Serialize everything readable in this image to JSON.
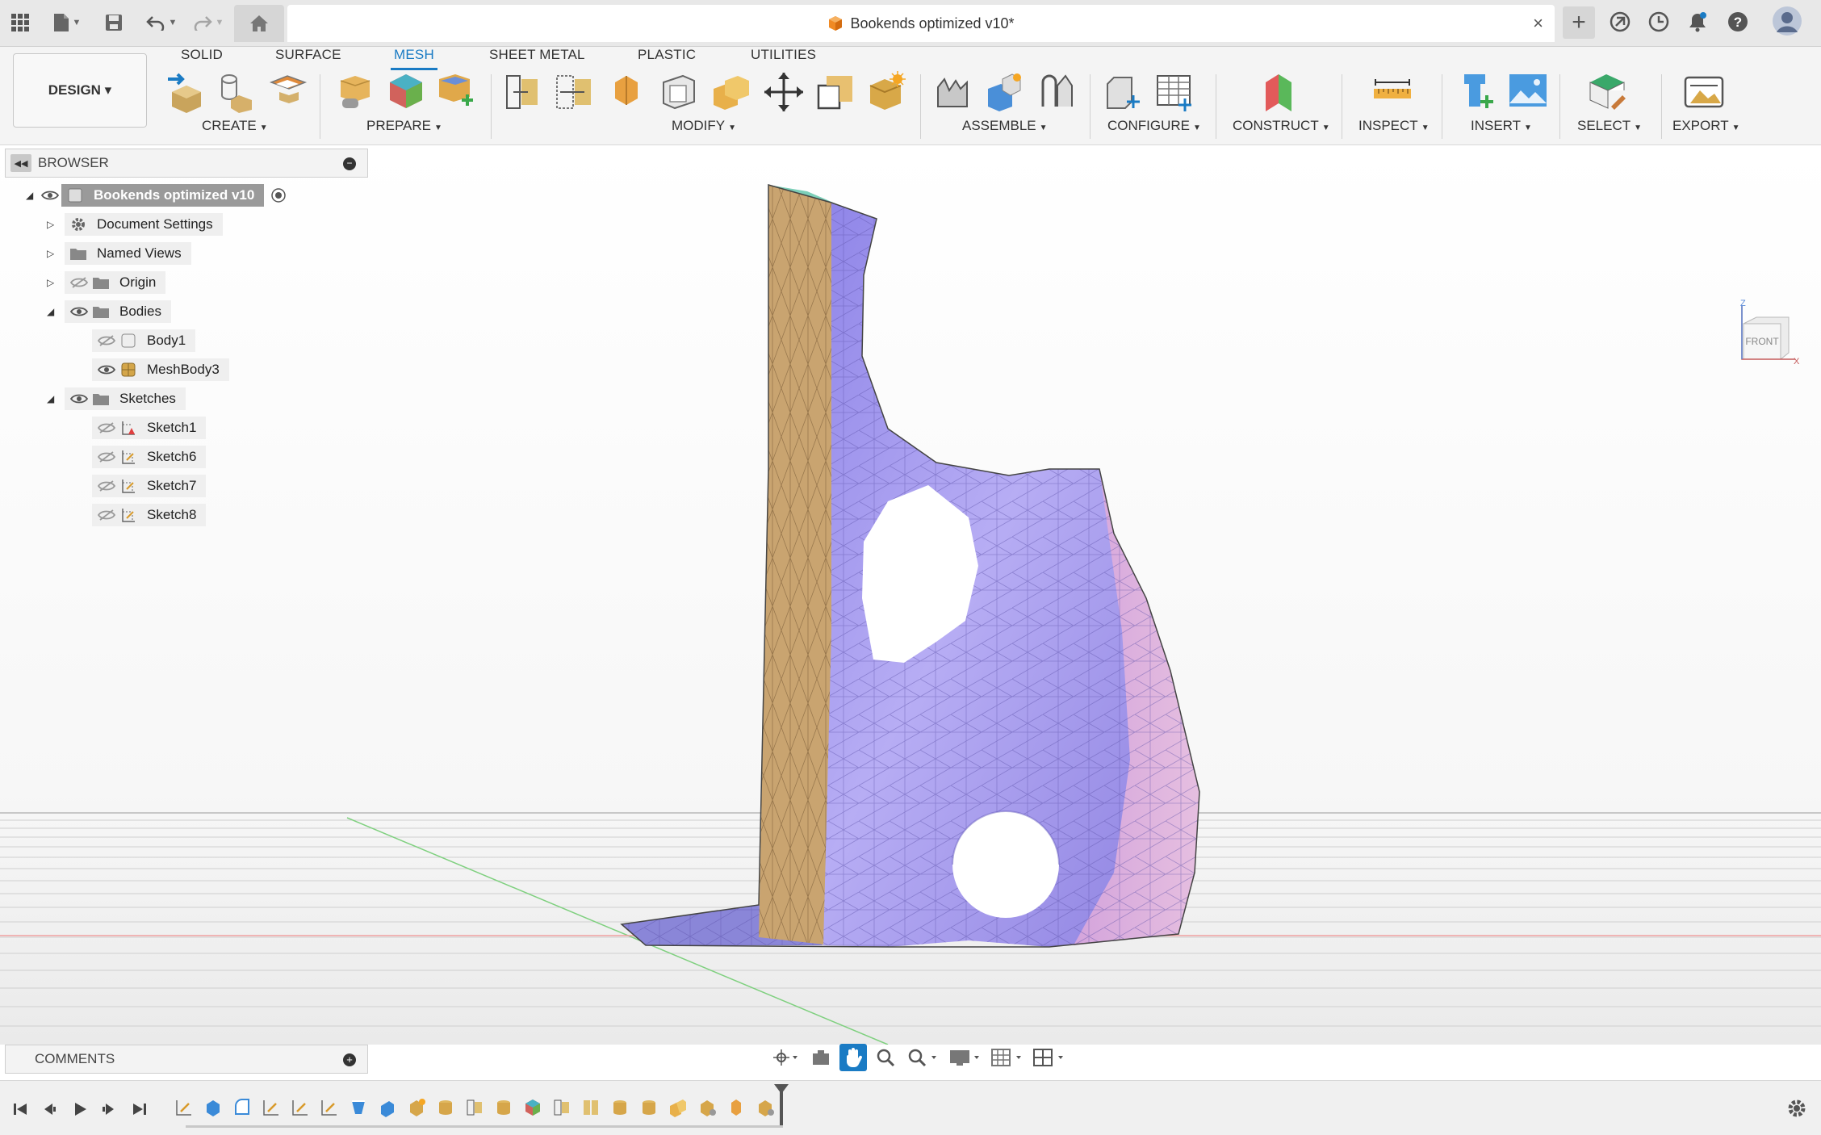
{
  "titlebar": {
    "document_title": "Bookends optimized v10*",
    "close_tab": "×",
    "new_tab": "+"
  },
  "toolbar": {
    "design_button": "DESIGN ▾",
    "workspace_tabs": [
      "SOLID",
      "SURFACE",
      "MESH",
      "SHEET METAL",
      "PLASTIC",
      "UTILITIES"
    ],
    "active_tab": "MESH",
    "groups": {
      "create": "CREATE",
      "prepare": "PREPARE",
      "modify": "MODIFY",
      "assemble": "ASSEMBLE",
      "configure": "CONFIGURE",
      "construct": "CONSTRUCT",
      "inspect": "INSPECT",
      "insert": "INSERT",
      "select": "SELECT",
      "export": "EXPORT"
    }
  },
  "browser": {
    "title": "BROWSER",
    "root": "Bookends optimized v10",
    "items": {
      "document_settings": "Document Settings",
      "named_views": "Named Views",
      "origin": "Origin",
      "bodies": "Bodies",
      "body1": "Body1",
      "meshbody3": "MeshBody3",
      "sketches": "Sketches",
      "sketch1": "Sketch1",
      "sketch6": "Sketch6",
      "sketch7": "Sketch7",
      "sketch8": "Sketch8"
    }
  },
  "viewcube": {
    "face": "FRONT",
    "axis_z": "Z",
    "axis_x": "X"
  },
  "comments": {
    "title": "COMMENTS"
  },
  "colors": {
    "accent": "#1a7bc4",
    "mesh_purple": "#a99cf0",
    "mesh_tan": "#c9a470",
    "mesh_pink": "#dcb0d8"
  }
}
